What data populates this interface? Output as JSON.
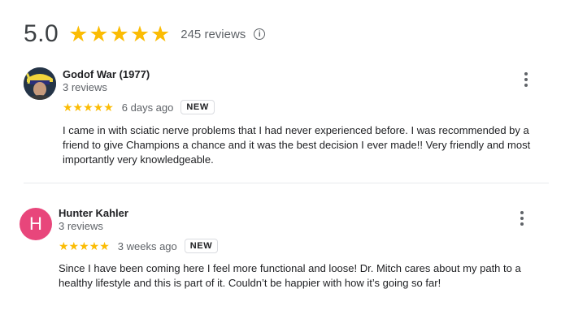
{
  "summary": {
    "rating": "5.0",
    "stars": "★★★★★",
    "review_count": "245 reviews",
    "info_icon": "info-icon"
  },
  "reviews": [
    {
      "author": "Godof War (1977)",
      "sub": "3 reviews",
      "stars": "★★★★★",
      "date": "6 days ago",
      "badge": "NEW",
      "avatar": "profile-photo",
      "text": "I came in with sciatic nerve problems that I had never experienced before. I was recommended by a friend to give Champions a chance and it was the best decision I ever made!! Very friendly and most importantly very knowledgeable."
    },
    {
      "author": "Hunter Kahler",
      "sub": "3 reviews",
      "stars": "★★★★★",
      "date": "3 weeks ago",
      "badge": "NEW",
      "avatar_letter": "H",
      "avatar_color": "#e8467b",
      "text": "Since I have been coming here I feel more functional and loose! Dr. Mitch cares about my path to a healthy lifestyle and this is part of it. Couldn’t be happier with how it’s going so far!"
    }
  ],
  "colors": {
    "star": "#fbbc04",
    "muted": "#5f6368",
    "text": "#202124"
  }
}
